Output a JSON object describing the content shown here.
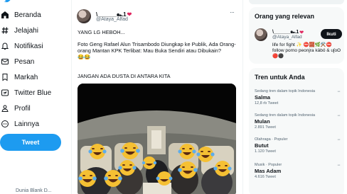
{
  "nav": {
    "items": [
      {
        "label": "Beranda",
        "icon": "home-icon"
      },
      {
        "label": "Jelajahi",
        "icon": "hashtag-icon"
      },
      {
        "label": "Notifikasi",
        "icon": "bell-icon"
      },
      {
        "label": "Pesan",
        "icon": "envelope-icon"
      },
      {
        "label": "Markah",
        "icon": "bookmark-icon"
      },
      {
        "label": "Twitter Blue",
        "icon": "twitter-blue-icon"
      },
      {
        "label": "Profil",
        "icon": "person-icon"
      },
      {
        "label": "Lainnya",
        "icon": "more-circle-icon"
      }
    ],
    "tweet_button": "Tweet",
    "user_fragment": "Dunia Blank D..."
  },
  "tweet": {
    "display_name": "\\______๛1",
    "heart": "❤",
    "handle": "@Ataya_Alfad",
    "line1": "YANG LG HEBOH...",
    "line2": "Foto Geng Rafael Alun Trisambodo Diungkap ke Publik, Ada Orang-orang Mantan KPK Terlibat: Mau Buka Sendiri atau Dibukain?",
    "emoji": "😂😂",
    "line3": "JANGAN ADA DUSTA DI ANTARA KITA"
  },
  "right": {
    "relevant": {
      "title": "Orang yang relevan",
      "display_name": "\\______๛1",
      "heart": "❤",
      "handle": "@Ataya_Alfad",
      "follow_label": "Ikuti",
      "bio": "life for fight ✨ ⛔🧱🌿⚒️⛔ follow porno peonjra käbö & uʃoʘ 🔴⚫"
    },
    "trends": {
      "title": "Tren untuk Anda",
      "items": [
        {
          "context": "Sedang tren dalam topik Indonesia",
          "name": "Salma",
          "count": "12,8 rb Tweet"
        },
        {
          "context": "Sedang tren dalam topik Indonesia",
          "name": "Mulan",
          "count": "2.891 Tweet"
        },
        {
          "context": "Olahraga · Populer",
          "name": "Butut",
          "count": "1.120 Tweet"
        },
        {
          "context": "Musik · Populer",
          "name": "Mas Adam",
          "count": "4.616 Tweet"
        }
      ]
    }
  },
  "colors": {
    "accent": "#1d9bf0",
    "text": "#0f1419",
    "muted": "#536471",
    "heart": "#e0245e",
    "panel": "#f7f9f9"
  }
}
